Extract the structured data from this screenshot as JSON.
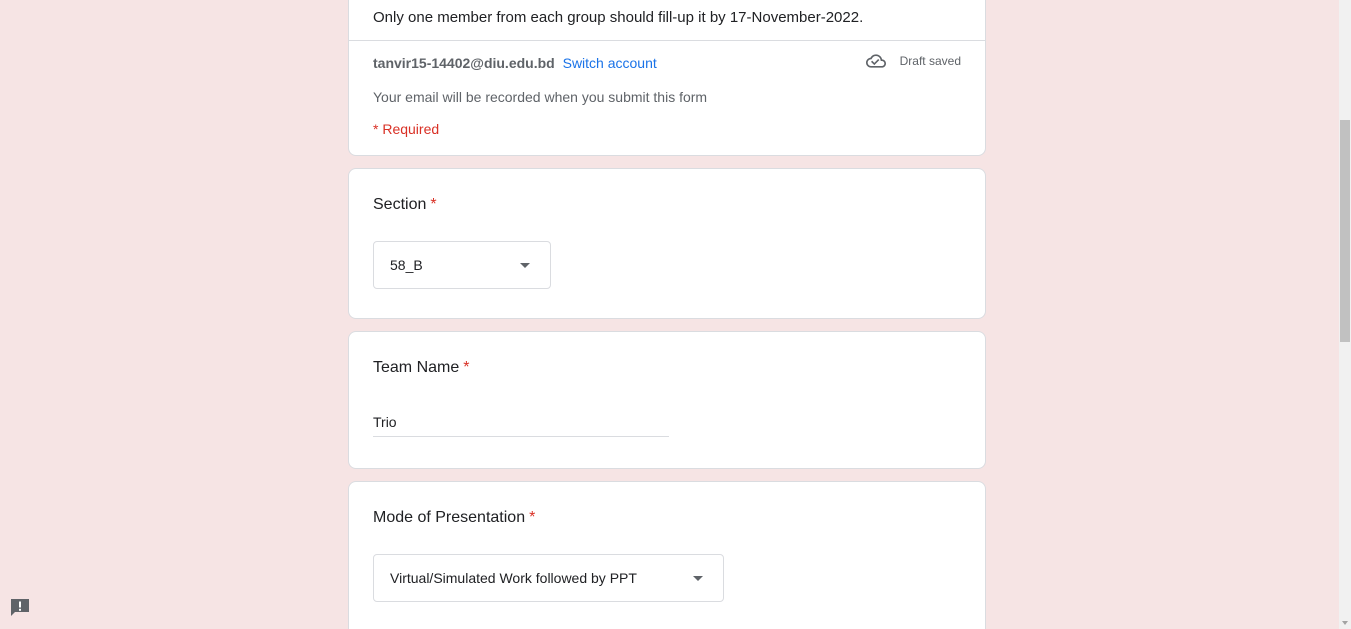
{
  "header": {
    "description": "Only one member from each group should fill-up it by 17-November-2022.",
    "account_email": "tanvir15-14402@diu.edu.bd",
    "switch_account_label": "Switch account",
    "draft_status": "Draft saved",
    "draft_icon": "cloud-done-icon",
    "email_notice": "Your email will be recorded when you submit this form",
    "required_note": "* Required"
  },
  "questions": {
    "section": {
      "title": "Section",
      "required_mark": "*",
      "selected_value": "58_B"
    },
    "team_name": {
      "title": "Team Name",
      "required_mark": "*",
      "value": "Trio"
    },
    "mode": {
      "title": "Mode of Presentation",
      "required_mark": "*",
      "selected_value": "Virtual/Simulated Work followed by PPT"
    }
  },
  "colors": {
    "background": "#f6e4e4",
    "required": "#d93025",
    "link": "#1a73e8"
  },
  "feedback_icon": "report-icon"
}
